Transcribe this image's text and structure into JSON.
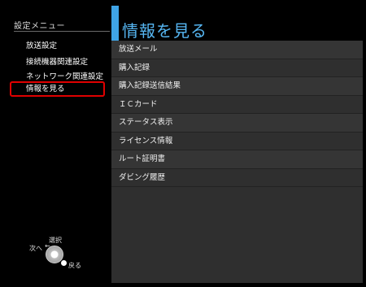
{
  "left_menu": {
    "title": "設定メニュー",
    "items": [
      {
        "label": "放送設定"
      },
      {
        "label": "接続機器関連設定"
      },
      {
        "label": "ネットワーク関連設定"
      },
      {
        "label": "情報を見る",
        "selected": true
      }
    ]
  },
  "header": {
    "title": "情報を見る"
  },
  "list": {
    "items": [
      "放送メール",
      "購入記録",
      "購入記録送信結果",
      "ＩＣカード",
      "ステータス表示",
      "ライセンス情報",
      "ルート証明書",
      "ダビング履歴"
    ]
  },
  "remote_hint": {
    "select": "選択",
    "next": "次へ",
    "arrow": "←",
    "back": "戻る"
  },
  "colors": {
    "accent": "#3fa4e6",
    "title": "#56b6f2",
    "selection_border": "#e00000",
    "panel": "#2f2f2f",
    "background": "#000000"
  }
}
